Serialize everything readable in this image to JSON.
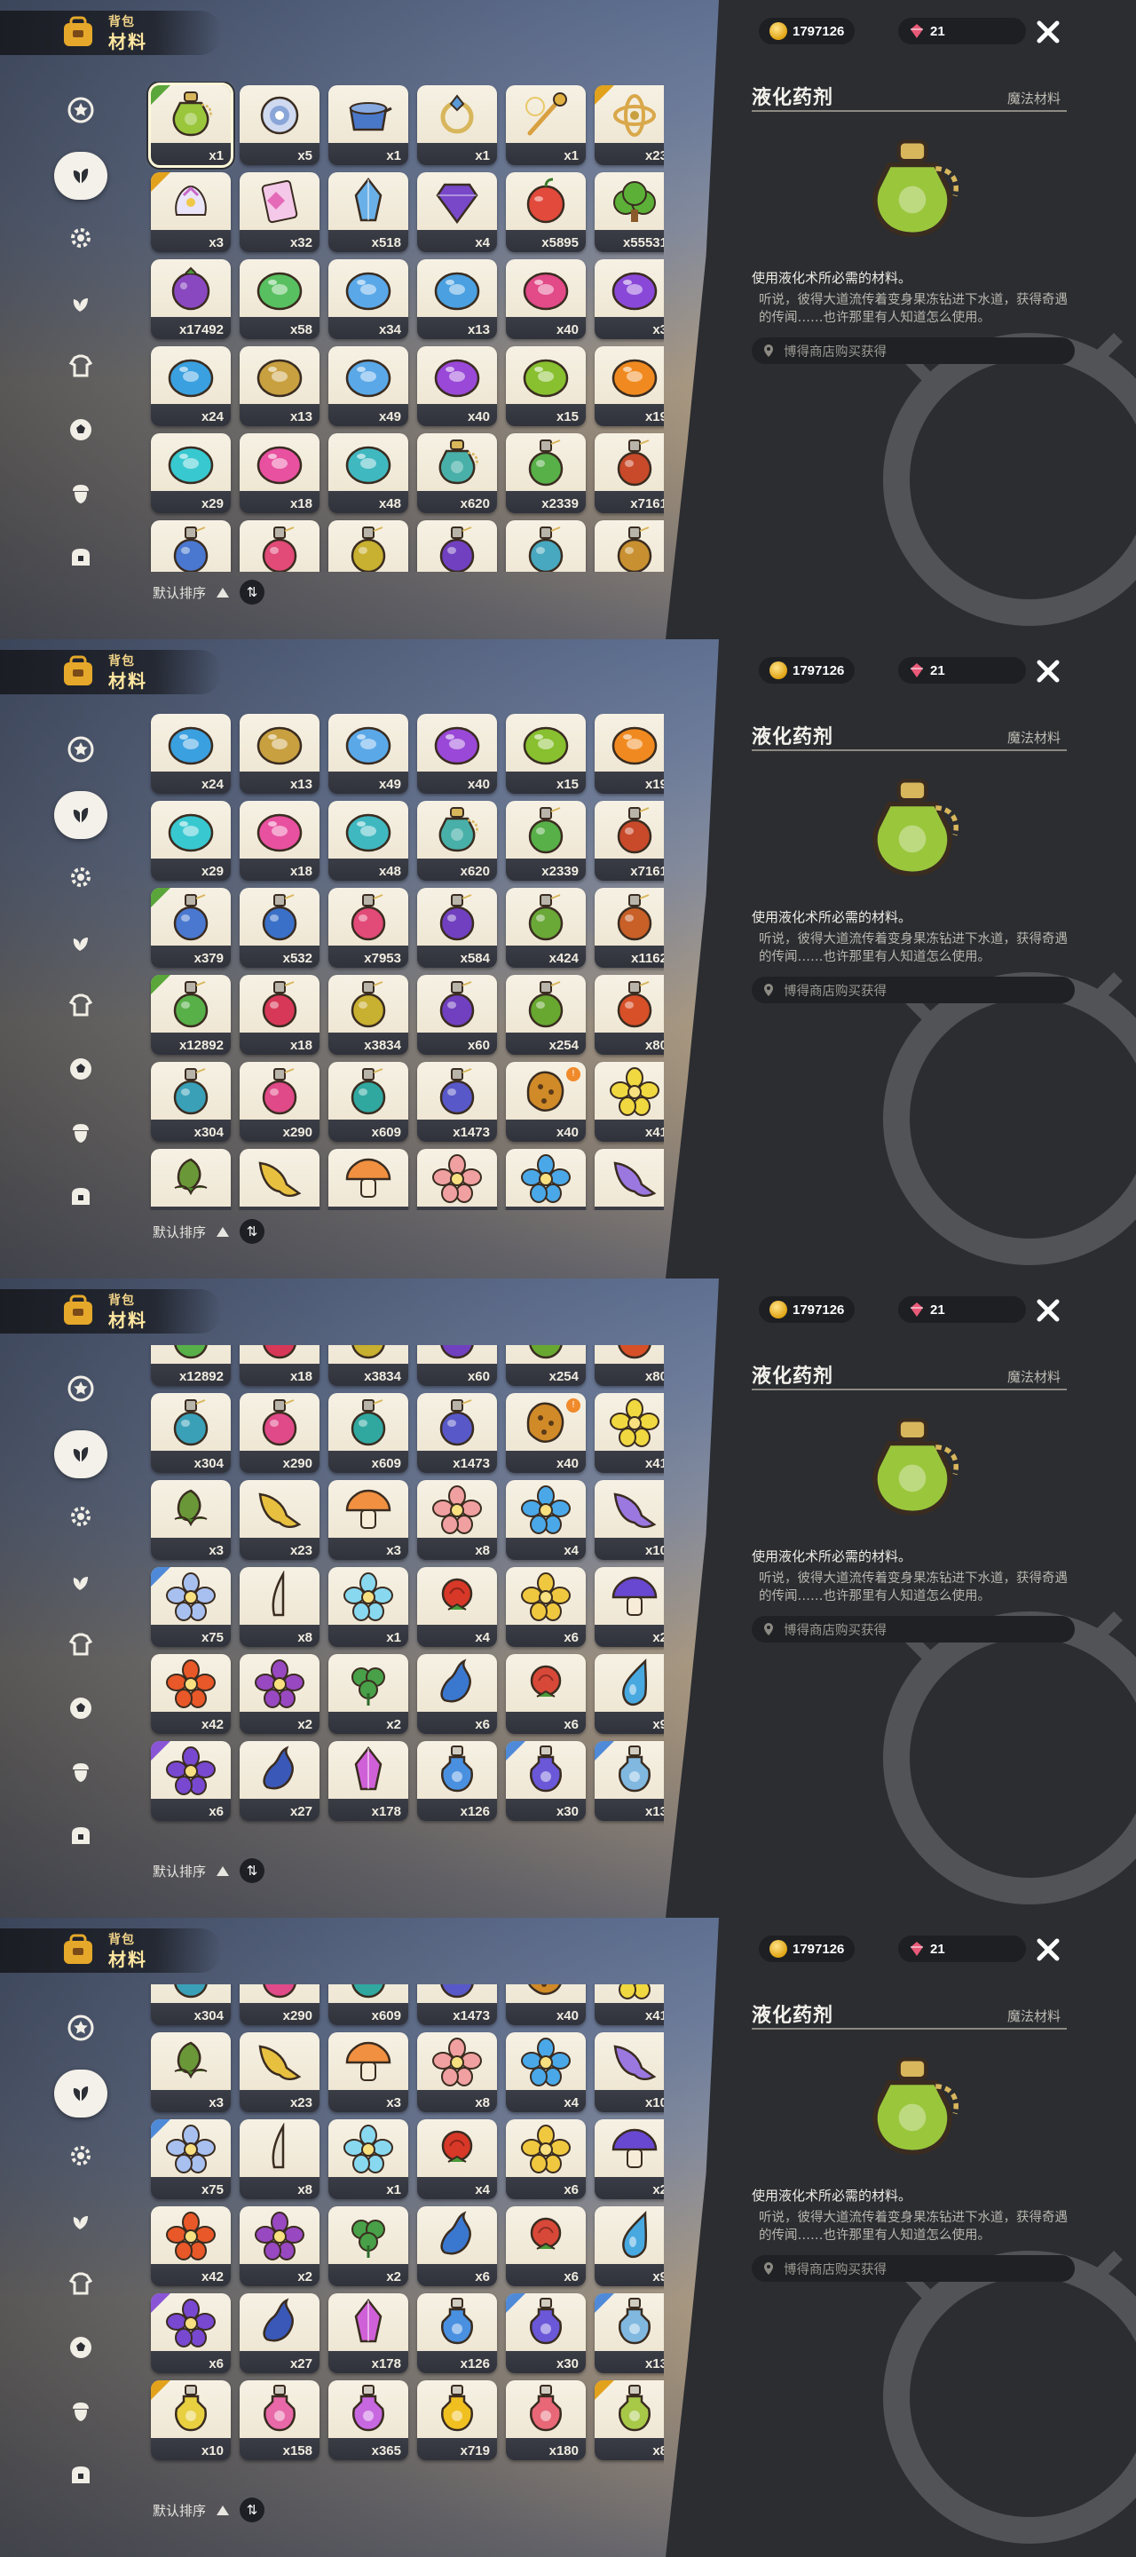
{
  "header": {
    "title_top": "背包",
    "title_main": "材料"
  },
  "sort": {
    "label": "默认排序",
    "toggle": "⇅"
  },
  "currency": {
    "coins": "1797126",
    "gems": "21"
  },
  "detail": {
    "name": "液化药剂",
    "category": "魔法材料",
    "description": "使用液化术所必需的材料。",
    "lore": "听说，彼得大道流传着变身果冻钻进下水道，获得奇遇的传闻……也许那里有人知道怎么使用。",
    "source": "博得商店购买获得"
  },
  "nav": [
    {
      "name": "nav-favorites",
      "icon": "star-icon"
    },
    {
      "name": "nav-materials",
      "icon": "leaf-icon"
    },
    {
      "name": "nav-gear",
      "icon": "gear-icon"
    },
    {
      "name": "nav-plants",
      "icon": "sprout-icon"
    },
    {
      "name": "nav-outfits",
      "icon": "shirt-icon"
    },
    {
      "name": "nav-sports",
      "icon": "ball-icon"
    },
    {
      "name": "nav-seeds",
      "icon": "acorn-icon"
    },
    {
      "name": "nav-furniture",
      "icon": "chest-icon"
    }
  ],
  "frames": [
    {
      "rows": [
        [
          {
            "t": "potion",
            "c": "#9ac63c",
            "n": "x1",
            "k": "green",
            "sel": true
          },
          {
            "t": "orb",
            "c": "#8aa6d8",
            "n": "x5",
            "k": ""
          },
          {
            "t": "pot",
            "c": "#4a78c8",
            "n": "x1",
            "k": ""
          },
          {
            "t": "ring",
            "c": "#5a9ad8",
            "n": "x1",
            "k": ""
          },
          {
            "t": "wand",
            "c": "#e0b040",
            "n": "x1",
            "k": ""
          },
          {
            "t": "gyro",
            "c": "#d9a84a",
            "n": "x23",
            "k": "gold"
          }
        ],
        [
          {
            "t": "gift",
            "c": "#d9c8f0",
            "n": "x3",
            "k": "gold"
          },
          {
            "t": "card",
            "c": "#e46ab8",
            "n": "x32",
            "k": ""
          },
          {
            "t": "crystal",
            "c": "#6ab0e8",
            "n": "x518",
            "k": ""
          },
          {
            "t": "gem",
            "c": "#7848c8",
            "n": "x4",
            "k": ""
          },
          {
            "t": "apple",
            "c": "#e24a3c",
            "n": "x5895",
            "k": ""
          },
          {
            "t": "bush",
            "c": "#5cb038",
            "n": "x55531",
            "k": ""
          }
        ],
        [
          {
            "t": "berry",
            "c": "#8a48c0",
            "n": "x17492",
            "k": ""
          },
          {
            "t": "jelly",
            "c": "#58c060",
            "n": "x58",
            "k": ""
          },
          {
            "t": "jelly",
            "c": "#5aa8e8",
            "n": "x34",
            "k": ""
          },
          {
            "t": "jelly",
            "c": "#4aa0e0",
            "n": "x13",
            "k": ""
          },
          {
            "t": "jelly",
            "c": "#e24a88",
            "n": "x40",
            "k": ""
          },
          {
            "t": "jelly",
            "c": "#8a48d8",
            "n": "x3",
            "k": ""
          }
        ],
        [
          {
            "t": "jelly",
            "c": "#3aa0e0",
            "n": "x24",
            "k": ""
          },
          {
            "t": "jelly",
            "c": "#c8a040",
            "n": "x13",
            "k": ""
          },
          {
            "t": "jelly",
            "c": "#5aa8e8",
            "n": "x49",
            "k": ""
          },
          {
            "t": "jelly",
            "c": "#9a48d8",
            "n": "x40",
            "k": ""
          },
          {
            "t": "jelly",
            "c": "#88c030",
            "n": "x15",
            "k": ""
          },
          {
            "t": "jelly",
            "c": "#f08a20",
            "n": "x19",
            "k": ""
          }
        ],
        [
          {
            "t": "jelly",
            "c": "#38c8d0",
            "n": "x29",
            "k": ""
          },
          {
            "t": "jelly",
            "c": "#e850a0",
            "n": "x18",
            "k": ""
          },
          {
            "t": "jelly",
            "c": "#40b8c0",
            "n": "x48",
            "k": ""
          },
          {
            "t": "potion",
            "c": "#48b0a8",
            "n": "x620",
            "k": ""
          },
          {
            "t": "flask",
            "c": "#58b048",
            "n": "x2339",
            "k": ""
          },
          {
            "t": "flask",
            "c": "#c84a2a",
            "n": "x7161",
            "k": ""
          }
        ],
        [
          {
            "t": "flask",
            "c": "#4a78d0",
            "n": "",
            "k": ""
          },
          {
            "t": "flask",
            "c": "#e24a78",
            "n": "",
            "k": ""
          },
          {
            "t": "flask",
            "c": "#c8b030",
            "n": "",
            "k": ""
          },
          {
            "t": "flask",
            "c": "#7040c0",
            "n": "",
            "k": ""
          },
          {
            "t": "flask",
            "c": "#48a8c0",
            "n": "",
            "k": ""
          },
          {
            "t": "flask",
            "c": "#c89030",
            "n": "",
            "k": ""
          }
        ]
      ]
    },
    {
      "rows": [
        [
          {
            "t": "jelly",
            "c": "#3aa0e0",
            "n": "x24",
            "k": ""
          },
          {
            "t": "jelly",
            "c": "#c8a040",
            "n": "x13",
            "k": ""
          },
          {
            "t": "jelly",
            "c": "#5aa8e8",
            "n": "x49",
            "k": ""
          },
          {
            "t": "jelly",
            "c": "#9a48d8",
            "n": "x40",
            "k": ""
          },
          {
            "t": "jelly",
            "c": "#88c030",
            "n": "x15",
            "k": ""
          },
          {
            "t": "jelly",
            "c": "#f08a20",
            "n": "x19",
            "k": ""
          }
        ],
        [
          {
            "t": "jelly",
            "c": "#38c8d0",
            "n": "x29",
            "k": ""
          },
          {
            "t": "jelly",
            "c": "#e850a0",
            "n": "x18",
            "k": ""
          },
          {
            "t": "jelly",
            "c": "#40b8c0",
            "n": "x48",
            "k": ""
          },
          {
            "t": "potion",
            "c": "#48b0a8",
            "n": "x620",
            "k": ""
          },
          {
            "t": "flask",
            "c": "#58b048",
            "n": "x2339",
            "k": ""
          },
          {
            "t": "flask",
            "c": "#c84a2a",
            "n": "x7161",
            "k": ""
          }
        ],
        [
          {
            "t": "flask",
            "c": "#4a78d0",
            "n": "x379",
            "k": "green"
          },
          {
            "t": "flask",
            "c": "#3a70c8",
            "n": "x532",
            "k": ""
          },
          {
            "t": "flask",
            "c": "#e24a78",
            "n": "x7953",
            "k": ""
          },
          {
            "t": "flask",
            "c": "#7040c0",
            "n": "x584",
            "k": ""
          },
          {
            "t": "flask",
            "c": "#6aa838",
            "n": "x424",
            "k": ""
          },
          {
            "t": "flask",
            "c": "#c86028",
            "n": "x1162",
            "k": ""
          }
        ],
        [
          {
            "t": "flask",
            "c": "#58b048",
            "n": "x12892",
            "k": "green"
          },
          {
            "t": "flask",
            "c": "#d83858",
            "n": "x18",
            "k": ""
          },
          {
            "t": "flask",
            "c": "#c8b030",
            "n": "x3834",
            "k": ""
          },
          {
            "t": "flask",
            "c": "#7040c0",
            "n": "x60",
            "k": ""
          },
          {
            "t": "flask",
            "c": "#68a830",
            "n": "x254",
            "k": ""
          },
          {
            "t": "flask",
            "c": "#d85028",
            "n": "x80",
            "k": ""
          }
        ],
        [
          {
            "t": "flask",
            "c": "#3aa0b8",
            "n": "x304",
            "k": ""
          },
          {
            "t": "flask",
            "c": "#e04a88",
            "n": "x290",
            "k": ""
          },
          {
            "t": "flask",
            "c": "#30a8a0",
            "n": "x609",
            "k": ""
          },
          {
            "t": "flask",
            "c": "#5858c8",
            "n": "x1473",
            "k": ""
          },
          {
            "t": "cookie",
            "c": "#d08a28",
            "n": "x40",
            "k": "",
            "b": true
          },
          {
            "t": "flower",
            "c": "#f0d840",
            "n": "x41",
            "k": ""
          }
        ],
        [
          {
            "t": "bud",
            "c": "#6a9838",
            "n": "",
            "k": ""
          },
          {
            "t": "trumpet",
            "c": "#e8c040",
            "n": "",
            "k": ""
          },
          {
            "t": "mushroom",
            "c": "#f09040",
            "n": "",
            "k": ""
          },
          {
            "t": "flower",
            "c": "#f0a0a0",
            "n": "",
            "k": ""
          },
          {
            "t": "flower",
            "c": "#4aa8e8",
            "n": "",
            "k": ""
          },
          {
            "t": "trumpet",
            "c": "#9a78e0",
            "n": "",
            "k": ""
          }
        ]
      ]
    },
    {
      "rows": [
        [
          {
            "t": "flask",
            "c": "#58b048",
            "n": "x12892",
            "k": "green"
          },
          {
            "t": "flask",
            "c": "#d83858",
            "n": "x18",
            "k": ""
          },
          {
            "t": "flask",
            "c": "#c8b030",
            "n": "x3834",
            "k": ""
          },
          {
            "t": "flask",
            "c": "#7040c0",
            "n": "x60",
            "k": ""
          },
          {
            "t": "flask",
            "c": "#68a830",
            "n": "x254",
            "k": ""
          },
          {
            "t": "flask",
            "c": "#d85028",
            "n": "x80",
            "k": ""
          }
        ],
        [
          {
            "t": "flask",
            "c": "#3aa0b8",
            "n": "x304",
            "k": ""
          },
          {
            "t": "flask",
            "c": "#e04a88",
            "n": "x290",
            "k": ""
          },
          {
            "t": "flask",
            "c": "#30a8a0",
            "n": "x609",
            "k": ""
          },
          {
            "t": "flask",
            "c": "#5858c8",
            "n": "x1473",
            "k": ""
          },
          {
            "t": "cookie",
            "c": "#d08a28",
            "n": "x40",
            "k": "",
            "b": true
          },
          {
            "t": "flower",
            "c": "#f0d840",
            "n": "x41",
            "k": ""
          }
        ],
        [
          {
            "t": "bud",
            "c": "#6a9838",
            "n": "x3",
            "k": ""
          },
          {
            "t": "trumpet",
            "c": "#e8c040",
            "n": "x23",
            "k": ""
          },
          {
            "t": "mushroom",
            "c": "#f09040",
            "n": "x3",
            "k": ""
          },
          {
            "t": "flower",
            "c": "#f0a0a0",
            "n": "x8",
            "k": ""
          },
          {
            "t": "flower",
            "c": "#4aa8e8",
            "n": "x4",
            "k": ""
          },
          {
            "t": "trumpet",
            "c": "#9a78e0",
            "n": "x10",
            "k": ""
          }
        ],
        [
          {
            "t": "flower",
            "c": "#a8c0f0",
            "n": "x75",
            "k": "blue"
          },
          {
            "t": "horn",
            "c": "#e8e0d0",
            "n": "x8",
            "k": ""
          },
          {
            "t": "flower",
            "c": "#88d8f0",
            "n": "x1",
            "k": ""
          },
          {
            "t": "rose",
            "c": "#d83828",
            "n": "x4",
            "k": ""
          },
          {
            "t": "flower",
            "c": "#f0c840",
            "n": "x6",
            "k": ""
          },
          {
            "t": "mushroom",
            "c": "#6848d0",
            "n": "x2",
            "k": ""
          }
        ],
        [
          {
            "t": "flower",
            "c": "#e85828",
            "n": "x42",
            "k": ""
          },
          {
            "t": "flower",
            "c": "#9848c0",
            "n": "x2",
            "k": ""
          },
          {
            "t": "clover",
            "c": "#48a048",
            "n": "x2",
            "k": ""
          },
          {
            "t": "vase",
            "c": "#3a78d0",
            "n": "x6",
            "k": ""
          },
          {
            "t": "rose",
            "c": "#d84838",
            "n": "x6",
            "k": ""
          },
          {
            "t": "drop",
            "c": "#48a8e0",
            "n": "x9",
            "k": ""
          }
        ],
        [
          {
            "t": "flower",
            "c": "#7848d0",
            "n": "x6",
            "k": "purple"
          },
          {
            "t": "vase",
            "c": "#3a58b8",
            "n": "x27",
            "k": ""
          },
          {
            "t": "crystal",
            "c": "#d060d8",
            "n": "x178",
            "k": ""
          },
          {
            "t": "bottle",
            "c": "#4a90e0",
            "n": "x126",
            "k": ""
          },
          {
            "t": "bottle",
            "c": "#6a58d8",
            "n": "x30",
            "k": "blue"
          },
          {
            "t": "bottle",
            "c": "#80b8e0",
            "n": "x13",
            "k": "blue"
          }
        ]
      ]
    },
    {
      "rows": [
        [
          {
            "t": "flask",
            "c": "#3aa0b8",
            "n": "x304",
            "k": ""
          },
          {
            "t": "flask",
            "c": "#e04a88",
            "n": "x290",
            "k": ""
          },
          {
            "t": "flask",
            "c": "#30a8a0",
            "n": "x609",
            "k": ""
          },
          {
            "t": "flask",
            "c": "#5858c8",
            "n": "x1473",
            "k": ""
          },
          {
            "t": "cookie",
            "c": "#d08a28",
            "n": "x40",
            "k": ""
          },
          {
            "t": "flower",
            "c": "#f0d840",
            "n": "x41",
            "k": ""
          }
        ],
        [
          {
            "t": "bud",
            "c": "#6a9838",
            "n": "x3",
            "k": ""
          },
          {
            "t": "trumpet",
            "c": "#e8c040",
            "n": "x23",
            "k": ""
          },
          {
            "t": "mushroom",
            "c": "#f09040",
            "n": "x3",
            "k": ""
          },
          {
            "t": "flower",
            "c": "#f0a0a0",
            "n": "x8",
            "k": ""
          },
          {
            "t": "flower",
            "c": "#4aa8e8",
            "n": "x4",
            "k": ""
          },
          {
            "t": "trumpet",
            "c": "#9a78e0",
            "n": "x10",
            "k": ""
          }
        ],
        [
          {
            "t": "flower",
            "c": "#a8c0f0",
            "n": "x75",
            "k": "blue"
          },
          {
            "t": "horn",
            "c": "#e8e0d0",
            "n": "x8",
            "k": ""
          },
          {
            "t": "flower",
            "c": "#88d8f0",
            "n": "x1",
            "k": ""
          },
          {
            "t": "rose",
            "c": "#d83828",
            "n": "x4",
            "k": ""
          },
          {
            "t": "flower",
            "c": "#f0c840",
            "n": "x6",
            "k": ""
          },
          {
            "t": "mushroom",
            "c": "#6848d0",
            "n": "x2",
            "k": ""
          }
        ],
        [
          {
            "t": "flower",
            "c": "#e85828",
            "n": "x42",
            "k": ""
          },
          {
            "t": "flower",
            "c": "#9848c0",
            "n": "x2",
            "k": ""
          },
          {
            "t": "clover",
            "c": "#48a048",
            "n": "x2",
            "k": ""
          },
          {
            "t": "vase",
            "c": "#3a78d0",
            "n": "x6",
            "k": ""
          },
          {
            "t": "rose",
            "c": "#d84838",
            "n": "x6",
            "k": ""
          },
          {
            "t": "drop",
            "c": "#48a8e0",
            "n": "x9",
            "k": ""
          }
        ],
        [
          {
            "t": "flower",
            "c": "#7848d0",
            "n": "x6",
            "k": "purple"
          },
          {
            "t": "vase",
            "c": "#3a58b8",
            "n": "x27",
            "k": ""
          },
          {
            "t": "crystal",
            "c": "#d060d8",
            "n": "x178",
            "k": ""
          },
          {
            "t": "bottle",
            "c": "#4a90e0",
            "n": "x126",
            "k": ""
          },
          {
            "t": "bottle",
            "c": "#6a58d8",
            "n": "x30",
            "k": "blue"
          },
          {
            "t": "bottle",
            "c": "#80b8e0",
            "n": "x13",
            "k": "blue"
          }
        ],
        [
          {
            "t": "bottle",
            "c": "#e8d040",
            "n": "x10",
            "k": "gold"
          },
          {
            "t": "bottle",
            "c": "#e868a8",
            "n": "x158",
            "k": ""
          },
          {
            "t": "bottle",
            "c": "#c868e0",
            "n": "x365",
            "k": ""
          },
          {
            "t": "bottle",
            "c": "#f0c020",
            "n": "x719",
            "k": ""
          },
          {
            "t": "bottle",
            "c": "#e86878",
            "n": "x180",
            "k": ""
          },
          {
            "t": "bottle",
            "c": "#a8c848",
            "n": "x8",
            "k": "gold"
          }
        ]
      ]
    }
  ]
}
